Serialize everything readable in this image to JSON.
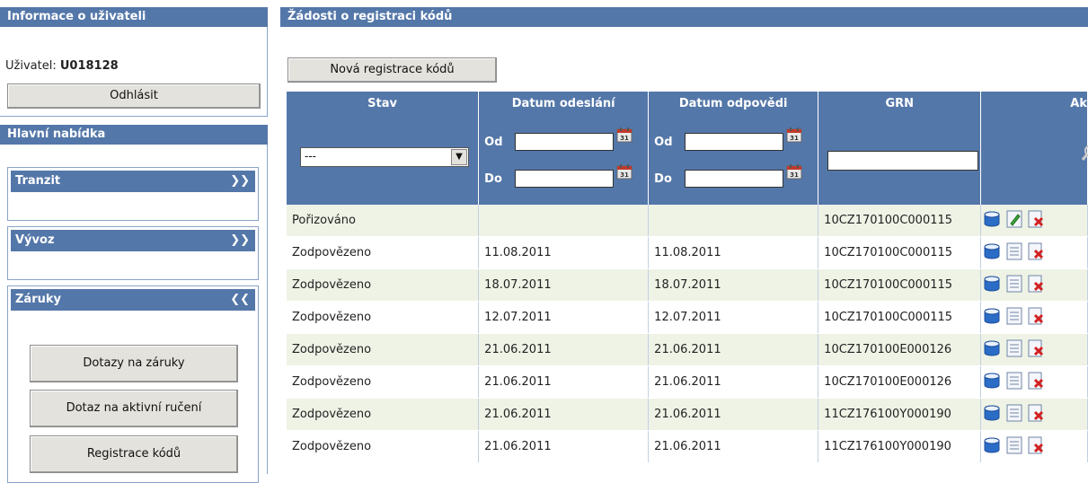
{
  "user_panel": {
    "title": "Informace o uživateli",
    "user_label": "Uživatel:",
    "user_id": "U018128",
    "logout": "Odhlásit"
  },
  "menu": {
    "title": "Hlavní nabídka",
    "sections": [
      {
        "label": "Tranzit",
        "state": "collapsed"
      },
      {
        "label": "Vývoz",
        "state": "collapsed"
      },
      {
        "label": "Záruky",
        "state": "expanded"
      }
    ],
    "items": [
      "Dotazy na záruky",
      "Dotaz na aktivní ručení",
      "Registrace kódů"
    ]
  },
  "main": {
    "title": "Žádosti o registraci kódů",
    "new_button": "Nová registrace kódů",
    "columns": {
      "stav": "Stav",
      "sent": "Datum odeslání",
      "reply": "Datum odpovědi",
      "grn": "GRN",
      "actions": "Ak"
    },
    "filters": {
      "from": "Od",
      "to": "Do",
      "stav_selected": "---"
    },
    "rows": [
      {
        "stav": "Pořizováno",
        "sent": "",
        "reply": "",
        "grn": "10CZ170100C000115",
        "edit": true
      },
      {
        "stav": "Zodpovězeno",
        "sent": "11.08.2011",
        "reply": "11.08.2011",
        "grn": "10CZ170100C000115",
        "edit": false
      },
      {
        "stav": "Zodpovězeno",
        "sent": "18.07.2011",
        "reply": "18.07.2011",
        "grn": "10CZ170100C000115",
        "edit": false
      },
      {
        "stav": "Zodpovězeno",
        "sent": "12.07.2011",
        "reply": "12.07.2011",
        "grn": "10CZ170100C000115",
        "edit": false
      },
      {
        "stav": "Zodpovězeno",
        "sent": "21.06.2011",
        "reply": "21.06.2011",
        "grn": "10CZ170100E000126",
        "edit": false
      },
      {
        "stav": "Zodpovězeno",
        "sent": "21.06.2011",
        "reply": "21.06.2011",
        "grn": "10CZ170100E000126",
        "edit": false
      },
      {
        "stav": "Zodpovězeno",
        "sent": "21.06.2011",
        "reply": "21.06.2011",
        "grn": "11CZ176100Y000190",
        "edit": false
      },
      {
        "stav": "Zodpovězeno",
        "sent": "21.06.2011",
        "reply": "21.06.2011",
        "grn": "11CZ176100Y000190",
        "edit": false
      }
    ]
  }
}
